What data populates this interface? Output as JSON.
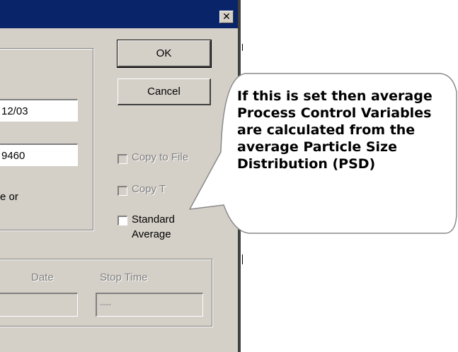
{
  "dialog": {
    "close_glyph": "✕",
    "fields": {
      "date": "12/03",
      "number": "9460",
      "stop_time": "----"
    },
    "labels": {
      "partial_text": "e or",
      "start_date_partial": "Date",
      "stop_time": "Stop Time"
    },
    "buttons": {
      "ok": "OK",
      "cancel": "Cancel"
    },
    "checkboxes": {
      "copy_to_file": "Copy to File",
      "copy_t": "Copy T",
      "standard_line1": "Standard",
      "standard_line2": "Average"
    }
  },
  "callout": {
    "text": "If this is set then average Process Control Variables are calculated from the average Particle Size Distribution (PSD)"
  }
}
